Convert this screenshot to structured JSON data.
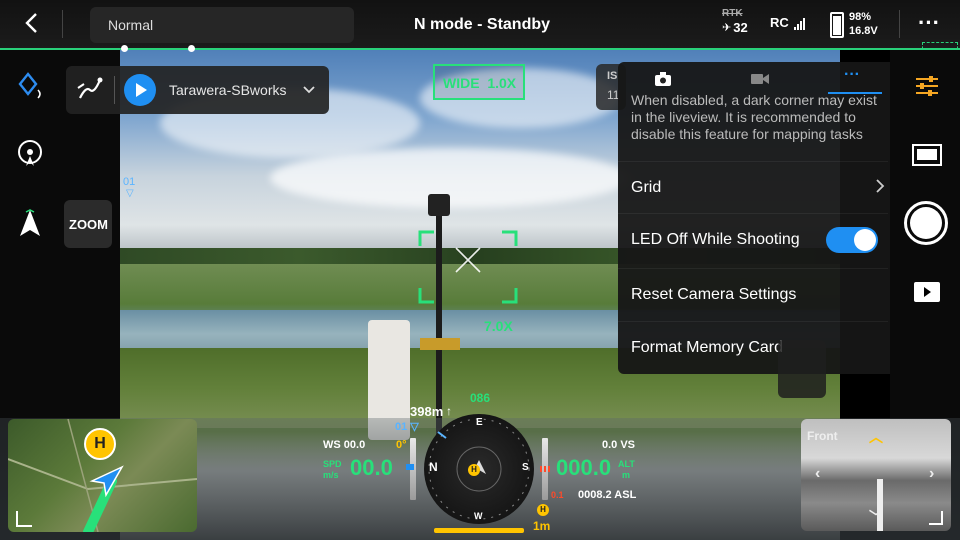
{
  "topbar": {
    "flight_mode": "Normal",
    "status": "N mode - Standby",
    "rtk_label": "RTK",
    "satellites": "32",
    "rc_label": "RC",
    "battery_percent": "98%",
    "battery_voltage": "16.8V",
    "more_label": "···"
  },
  "mission": {
    "name": "Tarawera-SBworks"
  },
  "left": {
    "zoom_label": "ZOOM",
    "waypoint_marker": "01"
  },
  "view": {
    "lens_label": "WIDE  1.0X",
    "zoom_level": "7.0X",
    "iso_label": "IS",
    "iso_value": "11"
  },
  "panel": {
    "tabs": [
      "camera-tab",
      "video-tab",
      "more-tab"
    ],
    "description": "When disabled, a dark corner may exist in the liveview. It is recommended to disable this feature for mapping tasks",
    "items": [
      {
        "label": "Grid"
      },
      {
        "label": "LED Off While Shooting",
        "toggle": true
      },
      {
        "label": "Reset Camera Settings"
      },
      {
        "label": "Format Memory Card"
      }
    ]
  },
  "telemetry": {
    "distance": "398m",
    "waypoint": "01",
    "heading": "086",
    "ws": "WS 00.0",
    "ws_tick": "0°",
    "spd_label_1": "SPD",
    "spd_label_2": "m/s",
    "speed": "00.0",
    "vs": "0.0 VS",
    "alt_label_1": "ALT",
    "alt_label_2": "m",
    "altitude": "000.0",
    "alt_small": "0.1",
    "asl": "0008.2 ASL",
    "home_distance": "1m",
    "compass_n": "N",
    "compass_e": "E",
    "compass_s": "S",
    "compass_w": "W"
  },
  "fpv": {
    "label": "Front"
  },
  "colors": {
    "accent_green": "#28e07a",
    "accent_blue": "#1f8ff2",
    "home_yellow": "#ffc400"
  }
}
